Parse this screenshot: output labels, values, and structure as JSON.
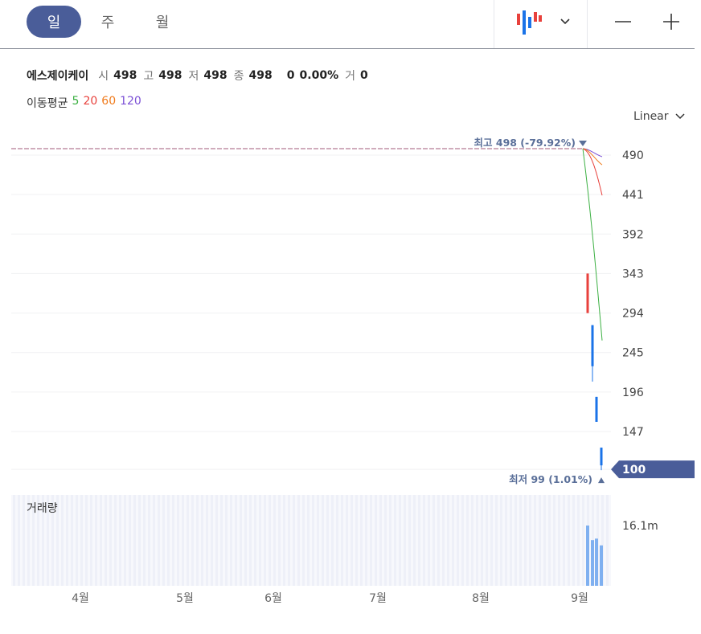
{
  "toolbar": {
    "periods": [
      {
        "label": "일",
        "active": true
      },
      {
        "label": "주",
        "active": false
      },
      {
        "label": "월",
        "active": false
      }
    ],
    "chart_type_icon": "candlestick-icon",
    "dropdown_icon": "chevron-down-icon",
    "zoom_out_icon": "minus-icon",
    "zoom_in_icon": "plus-icon"
  },
  "stock": {
    "name": "에스제이케이",
    "open_label": "시",
    "open": "498",
    "high_label": "고",
    "high": "498",
    "low_label": "저",
    "low": "498",
    "close_label": "종",
    "close": "498",
    "change": "0",
    "change_pct": "0.00%",
    "volume_label": "거",
    "volume": "0"
  },
  "moving_average": {
    "label": "이동평균",
    "periods": [
      {
        "label": "5",
        "color": "#3cb043"
      },
      {
        "label": "20",
        "color": "#e8413c"
      },
      {
        "label": "60",
        "color": "#f07c1e"
      },
      {
        "label": "120",
        "color": "#7b4fd6"
      }
    ]
  },
  "scale_label": "Linear",
  "chart_data": {
    "type": "candlestick",
    "y_ticks": [
      "490",
      "441",
      "392",
      "343",
      "294",
      "245",
      "196",
      "147"
    ],
    "x_ticks": [
      "4월",
      "5월",
      "6월",
      "7월",
      "8월",
      "9월"
    ],
    "high_marker": {
      "label": "최고",
      "value": "498 (-79.92%)"
    },
    "low_marker": {
      "label": "최저",
      "value": "99 (1.01%)"
    },
    "current_price": "100",
    "ylim": [
      99,
      498
    ],
    "candles": [
      {
        "open": 343,
        "close": 294,
        "high": 343,
        "low": 294,
        "direction": "up"
      },
      {
        "open": 279,
        "close": 228,
        "high": 279,
        "low": 209,
        "direction": "down"
      },
      {
        "open": 190,
        "close": 159,
        "high": 190,
        "low": 159,
        "direction": "down"
      },
      {
        "open": 127,
        "close": 105,
        "high": 127,
        "low": 99,
        "direction": "down"
      }
    ],
    "volume_label": "거래량",
    "volume_tick": "16.1m",
    "volumes": [
      16.1,
      12.2,
      12.6,
      10.8
    ]
  }
}
